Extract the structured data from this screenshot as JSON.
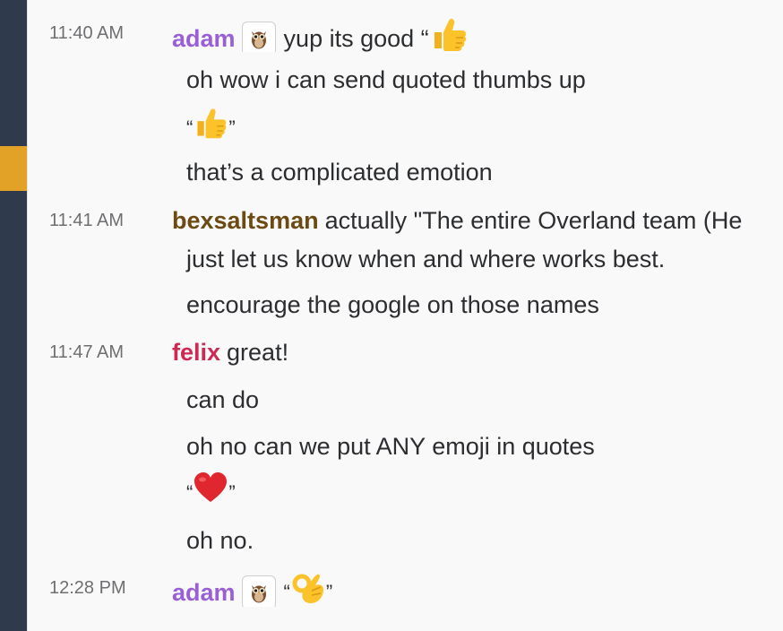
{
  "messages": [
    {
      "time": "11:40 AM",
      "author": "adam",
      "avatar_icon": "owl-icon",
      "text": "yup its good “",
      "emoji": "thumbs-up-icon",
      "close_quote": ""
    },
    {
      "text": "oh wow i can send quoted thumbs up"
    },
    {
      "open_quote": "“",
      "emoji": "thumbs-up-icon",
      "close_quote": "”"
    },
    {
      "text": "that’s a complicated emotion"
    },
    {
      "time": "11:41 AM",
      "author": "bexsaltsman",
      "text": "actually \"The entire Overland team (He"
    },
    {
      "text": "just let us know when and where works best."
    },
    {
      "text": "encourage the google on those names"
    },
    {
      "time": "11:47 AM",
      "author": "felix",
      "text": "great!"
    },
    {
      "text": "can do"
    },
    {
      "text": "oh no can we put ANY emoji in quotes"
    },
    {
      "open_quote": "“",
      "emoji": "red-heart-icon",
      "close_quote": "”"
    },
    {
      "text": "oh no."
    },
    {
      "time": "12:28 PM",
      "author": "adam",
      "avatar_icon": "owl-icon",
      "open_quote": "“",
      "emoji": "ok-hand-icon",
      "close_quote": "”"
    }
  ],
  "colors": {
    "sidebar": "#2f3a4d",
    "sidebar_marker": "#e2a227",
    "author_adam": "#9a5fd6",
    "author_bexsaltsman": "#6b4a14",
    "author_felix": "#cd2953",
    "timestamp": "#6f6f72"
  }
}
